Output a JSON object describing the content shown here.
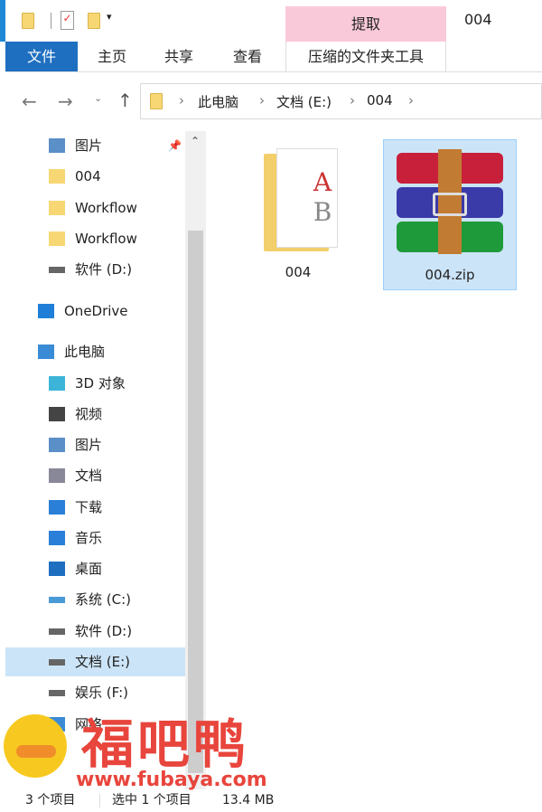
{
  "title_bar": {
    "context_tab": "提取",
    "window_title": "004"
  },
  "ribbon": {
    "tabs": [
      "文件",
      "主页",
      "共享",
      "查看",
      "压缩的文件夹工具"
    ]
  },
  "address_bar": {
    "crumbs": [
      "此电脑",
      "文档 (E:)",
      "004"
    ]
  },
  "nav_pane": {
    "items": [
      {
        "label": "图片",
        "icon": "pictures-icon"
      },
      {
        "label": "004",
        "icon": "folder-icon"
      },
      {
        "label": "Workflow",
        "icon": "folder-icon"
      },
      {
        "label": "Workflow",
        "icon": "folder-icon"
      },
      {
        "label": "软件 (D:)",
        "icon": "drive-icon"
      },
      {
        "label": "OneDrive",
        "icon": "cloud-icon"
      },
      {
        "label": "此电脑",
        "icon": "computer-icon"
      },
      {
        "label": "3D 对象",
        "icon": "3d-objects-icon"
      },
      {
        "label": "视频",
        "icon": "video-icon"
      },
      {
        "label": "图片",
        "icon": "pictures-icon"
      },
      {
        "label": "文档",
        "icon": "document-icon"
      },
      {
        "label": "下载",
        "icon": "download-icon"
      },
      {
        "label": "音乐",
        "icon": "music-icon"
      },
      {
        "label": "桌面",
        "icon": "desktop-icon"
      },
      {
        "label": "系统 (C:)",
        "icon": "system-drive-icon"
      },
      {
        "label": "软件 (D:)",
        "icon": "drive-icon"
      },
      {
        "label": "文档 (E:)",
        "icon": "drive-icon",
        "selected": true
      },
      {
        "label": "娱乐 (F:)",
        "icon": "drive-icon"
      },
      {
        "label": "网络",
        "icon": "network-icon"
      }
    ]
  },
  "files": [
    {
      "name": "004",
      "type": "folder"
    },
    {
      "name": "004.zip",
      "type": "winrar-archive",
      "selected": true
    }
  ],
  "status_bar": {
    "count": "3 个项目",
    "selection": "选中 1 个项目",
    "size": "13.4 MB"
  },
  "watermark": {
    "text": "福吧鸭",
    "url": "www.fubaya.com",
    "color": "#e8453c"
  },
  "colors": {
    "accent": "#1e6fc0",
    "context_tab": "#f9c9d9",
    "selection": "#cce4f7"
  }
}
